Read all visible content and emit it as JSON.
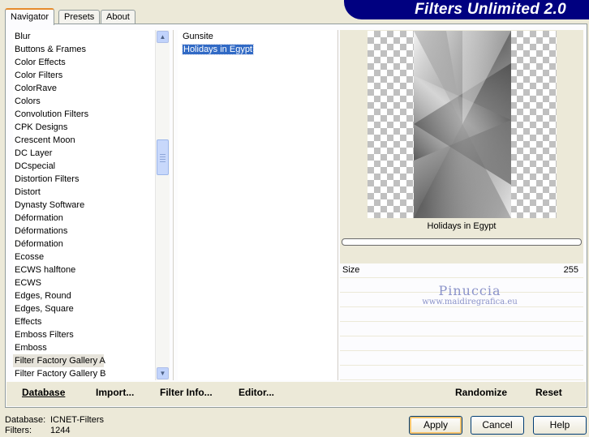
{
  "title": "Filters Unlimited 2.0",
  "tabs": [
    "Navigator",
    "Presets",
    "About"
  ],
  "categories": [
    "Blur",
    "Buttons & Frames",
    "Color Effects",
    "Color Filters",
    "ColorRave",
    "Colors",
    "Convolution Filters",
    "CPK Designs",
    "Crescent Moon",
    "DC Layer",
    "DCspecial",
    "Distortion Filters",
    "Distort",
    "Dynasty Software",
    "Déformation",
    "Déformations",
    "Déformation",
    "Ecosse",
    "ECWS halftone",
    "ECWS",
    "Edges, Round",
    "Edges, Square",
    "Effects",
    "Emboss Filters",
    "Emboss",
    "Filter Factory Gallery A",
    "Filter Factory Gallery B"
  ],
  "selected_category_index": 25,
  "filters": [
    "Gunsite",
    "Holidays in Egypt"
  ],
  "selected_filter_index": 1,
  "preview": {
    "filter_name": "Holidays in Egypt"
  },
  "params": {
    "size_label": "Size",
    "size_value": "255"
  },
  "watermark": {
    "line1": "Pinuccia",
    "line2": "www.maidiregrafica.eu"
  },
  "toolbar": {
    "database": "Database",
    "import": "Import...",
    "filter_info": "Filter Info...",
    "editor": "Editor...",
    "randomize": "Randomize",
    "reset": "Reset"
  },
  "footer": {
    "database_label": "Database:",
    "database_value": "ICNET-Filters",
    "filters_label": "Filters:",
    "filters_value": "1244"
  },
  "dialog": {
    "apply": "Apply",
    "cancel": "Cancel",
    "help": "Help"
  },
  "colors": {
    "banner": "#000080",
    "selection": "#316ac5",
    "face": "#ece9d8"
  }
}
